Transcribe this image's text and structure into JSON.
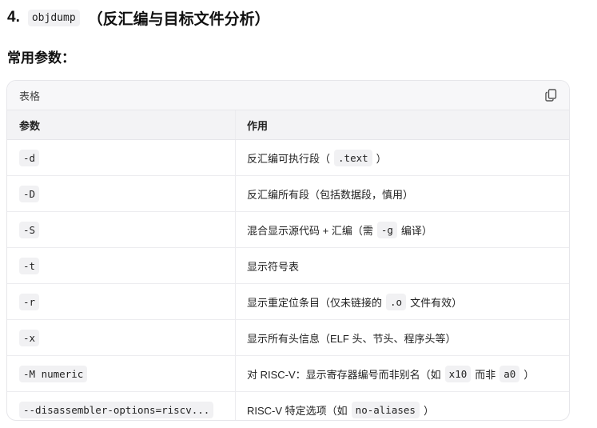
{
  "heading": {
    "number": "4.",
    "code": "objdump",
    "text": "（反汇编与目标文件分析）"
  },
  "subheading": "常用参数：",
  "table": {
    "caption": "表格",
    "copy_icon": "copy-icon",
    "headers": [
      "参数",
      "作用"
    ],
    "rows": [
      {
        "param": "-d",
        "desc": [
          {
            "t": "反汇编可执行段（"
          },
          {
            "c": ".text"
          },
          {
            "t": "）"
          }
        ]
      },
      {
        "param": "-D",
        "desc": [
          {
            "t": "反汇编所有段（包括数据段，慎用）"
          }
        ]
      },
      {
        "param": "-S",
        "desc": [
          {
            "t": "混合显示源代码 + 汇编（需"
          },
          {
            "c": "-g"
          },
          {
            "t": "编译）"
          }
        ]
      },
      {
        "param": "-t",
        "desc": [
          {
            "t": "显示符号表"
          }
        ]
      },
      {
        "param": "-r",
        "desc": [
          {
            "t": "显示重定位条目（仅未链接的"
          },
          {
            "c": ".o"
          },
          {
            "t": "文件有效）"
          }
        ]
      },
      {
        "param": "-x",
        "desc": [
          {
            "t": "显示所有头信息（ELF 头、节头、程序头等）"
          }
        ]
      },
      {
        "param": "-M numeric",
        "desc": [
          {
            "t": "对 RISC-V：显示寄存器编号而非别名（如"
          },
          {
            "c": "x10"
          },
          {
            "t": "而非"
          },
          {
            "c": "a0"
          },
          {
            "t": "）"
          }
        ]
      },
      {
        "param": "--disassembler-options=riscv...",
        "desc": [
          {
            "t": "RISC-V 特定选项（如"
          },
          {
            "c": "no-aliases"
          },
          {
            "t": "）"
          }
        ]
      }
    ]
  }
}
